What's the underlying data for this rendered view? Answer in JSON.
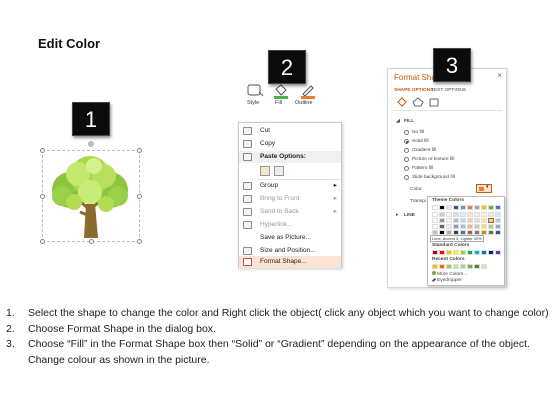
{
  "title": "Edit Color",
  "badges": [
    "1",
    "2",
    "3"
  ],
  "ribbon": {
    "style": "Style",
    "fill": "Fill",
    "outline": "Outline"
  },
  "context_menu": {
    "items": [
      "Cut",
      "Copy",
      "Paste Options:",
      "Group",
      "Bring to Front",
      "Send to Back",
      "Hyperlink...",
      "Save as Picture...",
      "Size and Position...",
      "Format Shape..."
    ],
    "arrows": {
      "group": "▸",
      "bring": "▸",
      "send": "▸"
    }
  },
  "format_pane": {
    "title": "Format Shape",
    "tabs": [
      "SHAPE OPTIONS",
      "TEXT OPTIONS"
    ],
    "fill_header": "FILL",
    "fill_options": [
      "No fill",
      "Solid fill",
      "Gradient fill",
      "Picture or texture fill",
      "Pattern fill",
      "Slide background fill"
    ],
    "color_label": "Color",
    "transparency_label": "Transparency",
    "line_header": "LINE"
  },
  "color_picker": {
    "theme_label": "Theme Colors",
    "tooltip": "Lime, Accent 3, Lighter 40%",
    "standard_label": "Standard Colors",
    "recent_label": "Recent Colors",
    "more_colors": "More Colors...",
    "eyedropper": "Eyedropper",
    "theme_colors": [
      "#ffffff",
      "#000000",
      "#e7e6e6",
      "#44546a",
      "#5b9bd5",
      "#ed7d31",
      "#a5a5a5",
      "#ffc000",
      "#70ad47",
      "#4472c4"
    ],
    "standard_colors": [
      "#c00000",
      "#ff0000",
      "#ffc000",
      "#ffff00",
      "#92d050",
      "#00b050",
      "#00b0f0",
      "#0070c0",
      "#002060",
      "#7030a0"
    ],
    "recent_colors": [
      "#ffc000",
      "#ff6600",
      "#92d050",
      "#c5e0b4",
      "#a9d18e",
      "#70ad47",
      "#548235",
      "#d9e8a7"
    ]
  },
  "instructions": [
    {
      "num": "1.",
      "text": "Select the shape to change the color and Right click the object( click any object which you want to change color)"
    },
    {
      "num": "2.",
      "text": "Choose Format Shape in the dialog box."
    },
    {
      "num": "3.",
      "text": "Choose “Fill” in the Format Shape box then “Solid” or “Gradient” depending on the appearance of the object. Change colour as shown in the picture."
    }
  ]
}
